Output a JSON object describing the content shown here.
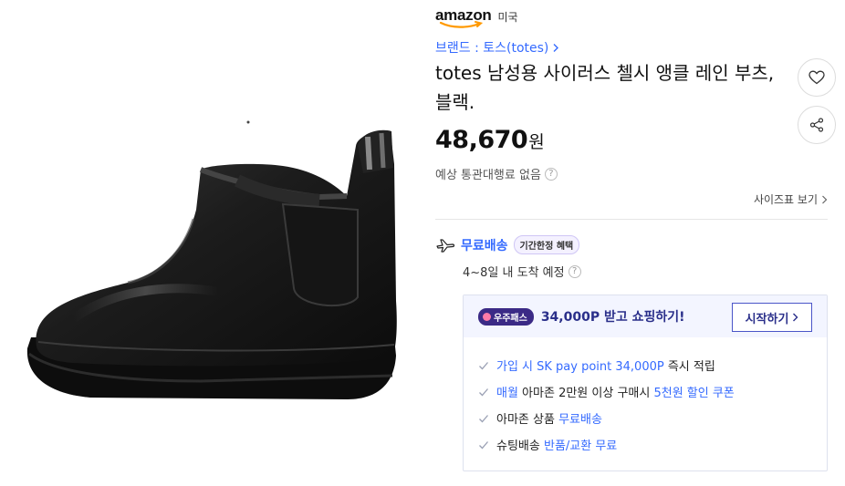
{
  "seller": {
    "logo": "amazon",
    "country": "미국"
  },
  "brand": {
    "label": "브랜드 : 토스(totes)"
  },
  "product": {
    "title": "totes 남성용 사이러스 첼시 앵클 레인 부츠, 블랙."
  },
  "price": {
    "value": "48,670",
    "unit": "원"
  },
  "customs": {
    "text": "예상 통관대행료 없음"
  },
  "size_chart": {
    "label": "사이즈표 보기"
  },
  "delivery": {
    "label": "무료배송",
    "badge": "기간한정 혜택",
    "eta": "4~8일 내 도착 예정"
  },
  "benefit_box": {
    "badge": "우주패스",
    "headline": "34,000P 받고 쇼핑하기!",
    "start_button": "시작하기",
    "items": [
      {
        "parts": [
          {
            "text": "가입 시 SK pay point 34,000P",
            "highlight": true
          },
          {
            "text": " 즉시 적립",
            "highlight": false
          }
        ]
      },
      {
        "parts": [
          {
            "text": "매월",
            "highlight": true
          },
          {
            "text": " 아마존 2만원 이상 구매시 ",
            "highlight": false
          },
          {
            "text": "5천원 할인 쿠폰",
            "highlight": true
          }
        ]
      },
      {
        "parts": [
          {
            "text": "아마존 상품 ",
            "highlight": false
          },
          {
            "text": "무료배송",
            "highlight": true
          }
        ]
      },
      {
        "parts": [
          {
            "text": "슈팅배송 ",
            "highlight": false
          },
          {
            "text": "반품/교환 무료",
            "highlight": true
          }
        ]
      }
    ]
  },
  "colors": {
    "link_blue": "#346aff",
    "navy": "#2a2f8a",
    "badge_purple": "#3b2a86"
  },
  "icons": {
    "wishlist": "heart-icon",
    "share": "share-icon",
    "delivery": "plane-icon",
    "help": "question-icon",
    "check": "check-icon"
  }
}
